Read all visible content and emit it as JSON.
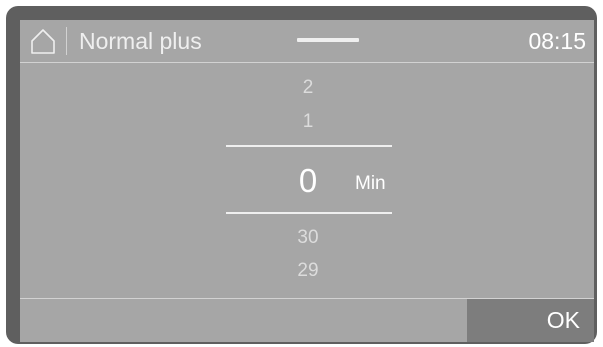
{
  "header": {
    "home_icon": "home-icon",
    "program": "Normal plus",
    "time": "08:15"
  },
  "picker": {
    "above": [
      "2",
      "1"
    ],
    "selected": "0",
    "unit": "Min",
    "below": [
      "30",
      "29"
    ]
  },
  "footer": {
    "ok_label": "OK"
  },
  "colors": {
    "screen_background": "#a6a6a6",
    "bezel": "#5f5f5f",
    "ok_button": "#7d7d7d"
  }
}
